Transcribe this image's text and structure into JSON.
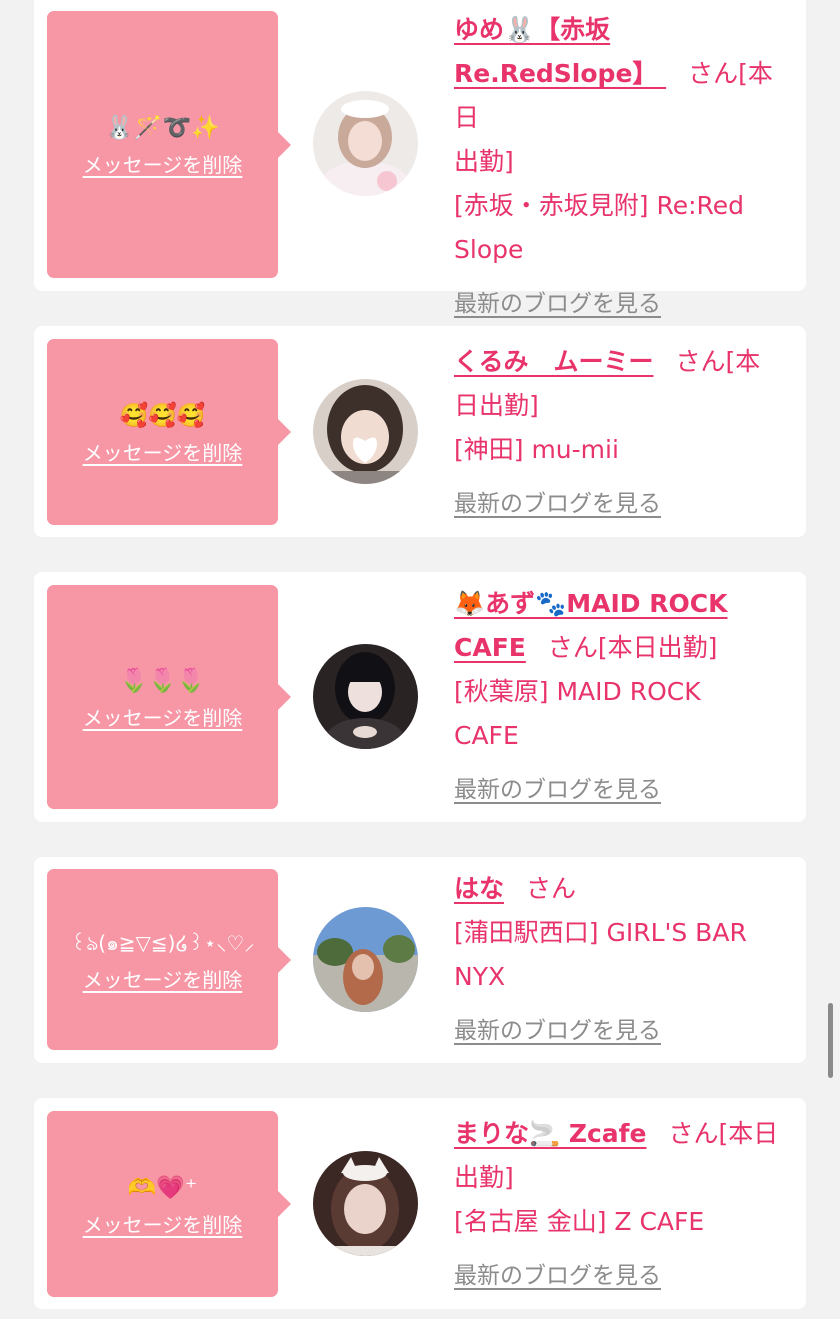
{
  "delete_label": "メッセージを削除",
  "blog_label": "最新のブログを見る",
  "san": "さん",
  "colors": {
    "bubble": "#f796a5",
    "accent": "#e8336b",
    "muted": "#8c8c8c",
    "bg": "#f2f2f2"
  },
  "cards": [
    {
      "message": "🐰🪄➰✨",
      "name_lines": [
        "ゆめ🐰【赤坂",
        "Re.RedSlope】 "
      ],
      "after_name": "[本日",
      "extra_lines": [
        "出勤]",
        "[赤坂・赤坂見附] Re:Red",
        "Slope"
      ],
      "avatar_icon": "avatar-photo-white-bow"
    },
    {
      "message": "🥰🥰🥰",
      "name_lines": [
        "くるみ　ムーミー"
      ],
      "after_name": "[本",
      "extra_lines": [
        "日出勤]",
        "[神田] mu-mii"
      ],
      "avatar_icon": "avatar-photo-dark-hair"
    },
    {
      "message": "🌷🌷🌷",
      "name_lines": [
        "🦊あず🐾MAID ROCK",
        "CAFE"
      ],
      "after_name": "[本日出勤]",
      "extra_lines": [
        "[秋葉原] MAID ROCK",
        "CAFE"
      ],
      "avatar_icon": "avatar-photo-black-twintails"
    },
    {
      "message": "꒰ঌ(๑≧▽≦)໒꒱⋆⸜♡⸝",
      "name_lines": [
        "はな"
      ],
      "after_name": "",
      "extra_lines": [
        "[蒲田駅西口] GIRL'S BAR",
        "NYX"
      ],
      "avatar_icon": "avatar-photo-outdoor-sky"
    },
    {
      "message": "🫶💗⁺",
      "name_lines": [
        "まりな🚬 Zcafe"
      ],
      "after_name": "[本日",
      "extra_lines": [
        "出勤]",
        "[名古屋 金山] Z CAFE"
      ],
      "avatar_icon": "avatar-photo-cat-ears"
    }
  ]
}
